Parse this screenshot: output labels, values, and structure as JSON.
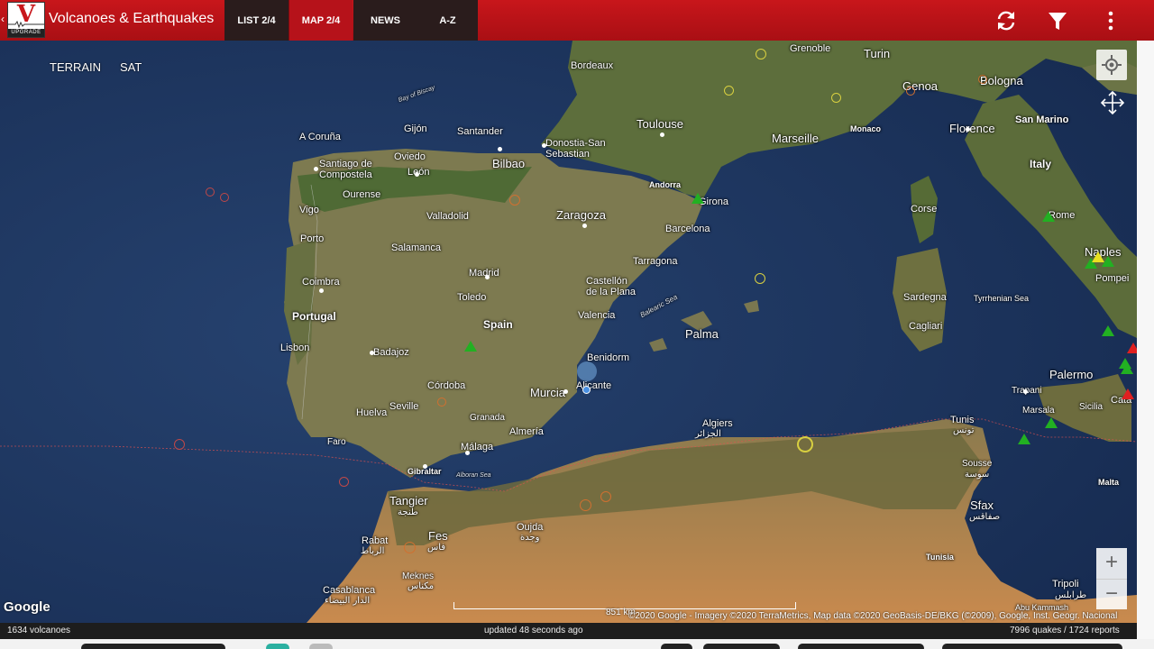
{
  "app": {
    "title": "Volcanoes & Earthquakes",
    "logo_letter": "V",
    "logo_caption": "UPGRADE",
    "back_glyph": "‹",
    "brand_color": "#c8161b"
  },
  "tabs": [
    {
      "label": "LIST 2/4"
    },
    {
      "label": "MAP 2/4"
    },
    {
      "label": "NEWS"
    },
    {
      "label": "A-Z"
    }
  ],
  "toolbar": {
    "icons": [
      "refresh-icon",
      "filter-icon",
      "more-vert-icon"
    ]
  },
  "map": {
    "map_types": [
      "TERRAIN",
      "SAT"
    ],
    "zoom_in": "+",
    "zoom_out": "−",
    "google_logo": "Google",
    "scale_label": "851 km",
    "attribution": "©2020 Google - Imagery ©2020 TerraMetrics, Map data ©2020 GeoBasis-DE/BKG (©2009), Google, Inst. Geogr. Nacional",
    "labels": {
      "bordeaux": "Bordeaux",
      "grenoble": "Grenoble",
      "turin": "Turin",
      "genoa": "Genoa",
      "bologna": "Bologna",
      "toulouse": "Toulouse",
      "monaco": "Monaco",
      "marseille": "Marseille",
      "florence": "Florence",
      "san_marino": "San Marino",
      "italy": "Italy",
      "bay_of_biscay": "Bay of Biscay",
      "a_coruna": "A Coruña",
      "gijon": "Gijón",
      "santander": "Santander",
      "donostia": "Donostia-San\nSebastian",
      "oviedo": "Oviedo",
      "bilbao": "Bilbao",
      "santiago": "Santiago de\nCompostela",
      "leon": "León",
      "andorra": "Andorra",
      "girona": "Girona",
      "corse": "Corse",
      "rome": "Rome",
      "ourense": "Ourense",
      "vigo": "Vigo",
      "valladolid": "Valladolid",
      "zaragoza": "Zaragoza",
      "barcelona": "Barcelona",
      "porto": "Porto",
      "salamanca": "Salamanca",
      "tarragona": "Tarragona",
      "naples": "Naples",
      "pompei": "Pompei",
      "madrid": "Madrid",
      "coimbra": "Coimbra",
      "castellon": "Castellón\nde la Plana",
      "sardegna": "Sardegna",
      "tyrrhenian": "Tyrrhenian Sea",
      "toledo": "Toledo",
      "portugal": "Portugal",
      "spain": "Spain",
      "valencia": "Valencia",
      "balearic": "Balearic Sea",
      "cagliari": "Cagliari",
      "palma": "Palma",
      "lisbon": "Lisbon",
      "badajoz": "Badajoz",
      "benidorm": "Benidorm",
      "palermo": "Palermo",
      "cordoba": "Córdoba",
      "murcia": "Murcia",
      "alicante": "Alicante",
      "trapani": "Trapani",
      "huelva": "Huelva",
      "seville": "Seville",
      "catania": "Cata",
      "granada": "Granada",
      "marsala": "Marsala",
      "sicilia": "Sicilia",
      "tunis": "Tunis",
      "tunis_ar": "تونس",
      "algiers": "Algiers",
      "algiers_ar": "الجزائر",
      "almeria": "Almería",
      "faro": "Faro",
      "malaga": "Málaga",
      "sousse": "Sousse",
      "sousse_ar": "سوسة",
      "gibraltar": "Gibraltar",
      "alboran": "Alboran Sea",
      "malta": "Malta",
      "tangier": "Tangier",
      "tangier_ar": "طنجة",
      "sfax": "Sfax",
      "sfax_ar": "صفاقس",
      "oujda": "Oujda",
      "oujda_ar": "وجدة",
      "fes": "Fes",
      "fes_ar": "فاس",
      "rabat": "Rabat",
      "rabat_ar": "الرباط",
      "tunisia": "Tunisia",
      "meknes": "Meknes",
      "meknes_ar": "مكناس",
      "casablanca": "Casablanca",
      "casablanca_ar": "الدار البيضاء",
      "tripoli": "Tripoli",
      "tripoli_ar": "طرابلس",
      "abu_kammash": "Abu Kammash"
    }
  },
  "status": {
    "volcano_count": "1634 volcanoes",
    "updated": "updated 48 seconds ago",
    "reports": "7996 quakes / 1724 reports"
  },
  "colors": {
    "volcano_active": "#22b022",
    "volcano_warning": "#e8e020",
    "volcano_erupting": "#e02020",
    "quake_ring_orange": "#d07030",
    "quake_ring_red": "#c04848",
    "quake_ring_yellow": "#d8d040"
  }
}
